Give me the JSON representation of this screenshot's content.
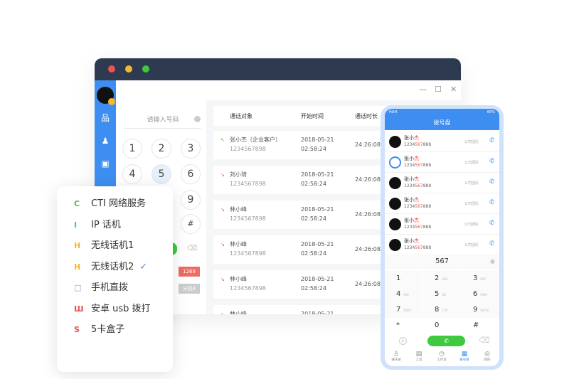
{
  "window": {
    "controls": [
      "—",
      "☐",
      "✕"
    ],
    "sidebar_icons": [
      "org-chart-icon",
      "contacts-icon",
      "calendar-icon"
    ]
  },
  "dialer": {
    "placeholder": "请输入号码",
    "keys": [
      "1",
      "2",
      "3",
      "4",
      "5",
      "6",
      "9",
      "#"
    ],
    "badge_red": "1269",
    "badge_gray": "分机4"
  },
  "table": {
    "headers": [
      "通话对象",
      "开始时间",
      "通话时长"
    ],
    "rows": [
      {
        "name": "张小杰（企业客户）",
        "number": "1234567898",
        "date": "2018-05-21",
        "time": "02:58:24",
        "duration": "24:26:08",
        "direction": "outgoing"
      },
      {
        "name": "刘小琦",
        "number": "1234567898",
        "date": "2018-05-21",
        "time": "02:58:24",
        "duration": "24:26:08",
        "direction": "missed"
      },
      {
        "name": "林小峰",
        "number": "1234567898",
        "date": "2018-05-21",
        "time": "02:58:24",
        "duration": "24:26:08",
        "direction": "missed"
      },
      {
        "name": "林小峰",
        "number": "1234567898",
        "date": "2018-05-21",
        "time": "02:58:24",
        "duration": "24:26:08",
        "direction": "missed"
      },
      {
        "name": "林小峰",
        "number": "1234567898",
        "date": "2018-05-21",
        "time": "02:58:24",
        "duration": "24:26:08",
        "direction": "missed"
      },
      {
        "name": "林小峰",
        "number": "",
        "date": "2018-05-21",
        "time": "",
        "duration": "",
        "direction": "missed"
      }
    ]
  },
  "menu": {
    "items": [
      {
        "icon": "C",
        "label": "CTI 网络服务",
        "color": "#3ec93e"
      },
      {
        "icon": "I",
        "label": "IP 话机",
        "color": "#2ec4c4"
      },
      {
        "icon": "H",
        "label": "无线话机1",
        "color": "#f5b82e"
      },
      {
        "icon": "H",
        "label": "无线话机2",
        "color": "#f5b82e",
        "checked": true
      },
      {
        "icon": "□",
        "label": "手机直拨",
        "color": "#c07ae8"
      },
      {
        "icon": "Ш",
        "label": "安卓 usb 拨打",
        "color": "#e84d4d"
      },
      {
        "icon": "S",
        "label": "5卡盒子",
        "color": "#e84d4d"
      }
    ],
    "check": "✓"
  },
  "phone": {
    "carrier": "HUH",
    "battery": "66%",
    "title": "拨号盘",
    "contacts": [
      {
        "name_a": "张小",
        "name_b": "杰",
        "num_a": "1234",
        "num_b": "567",
        "num_c": "888",
        "team": "公司团队",
        "avatar": "photo"
      },
      {
        "name_a": "张小",
        "name_b": "杰",
        "num_a": "1234",
        "num_b": "567",
        "num_c": "888",
        "team": "公司团队",
        "avatar": "bot"
      },
      {
        "name_a": "张小",
        "name_b": "杰",
        "num_a": "1234",
        "num_b": "567",
        "num_c": "888",
        "team": "公司团队",
        "avatar": "photo"
      },
      {
        "name_a": "张小",
        "name_b": "杰",
        "num_a": "1234",
        "num_b": "567",
        "num_c": "888",
        "team": "公司团队",
        "avatar": "photo"
      },
      {
        "name_a": "张小",
        "name_b": "杰",
        "num_a": "1234",
        "num_b": "567",
        "num_c": "888",
        "team": "公司团队",
        "avatar": "photo"
      },
      {
        "name_a": "张小",
        "name_b": "杰",
        "num_a": "1234",
        "num_b": "567",
        "num_c": "888",
        "team": "公司团队",
        "avatar": "photo"
      }
    ],
    "input": "567",
    "keys": [
      [
        "1",
        ""
      ],
      [
        "2",
        "ABC"
      ],
      [
        "3",
        "DEF"
      ],
      [
        "4",
        "GHI"
      ],
      [
        "5",
        "JKL"
      ],
      [
        "6",
        "MNO"
      ],
      [
        "7",
        "PQRS"
      ],
      [
        "8",
        "TUV"
      ],
      [
        "9",
        "WXYZ"
      ],
      [
        "*",
        ""
      ],
      [
        "0",
        ""
      ],
      [
        "#",
        ""
      ]
    ],
    "tabs": [
      "通讯录",
      "工具",
      "工作台",
      "拨号盘",
      "我的"
    ],
    "active_tab": 3,
    "accent": "#3d8ef0"
  }
}
